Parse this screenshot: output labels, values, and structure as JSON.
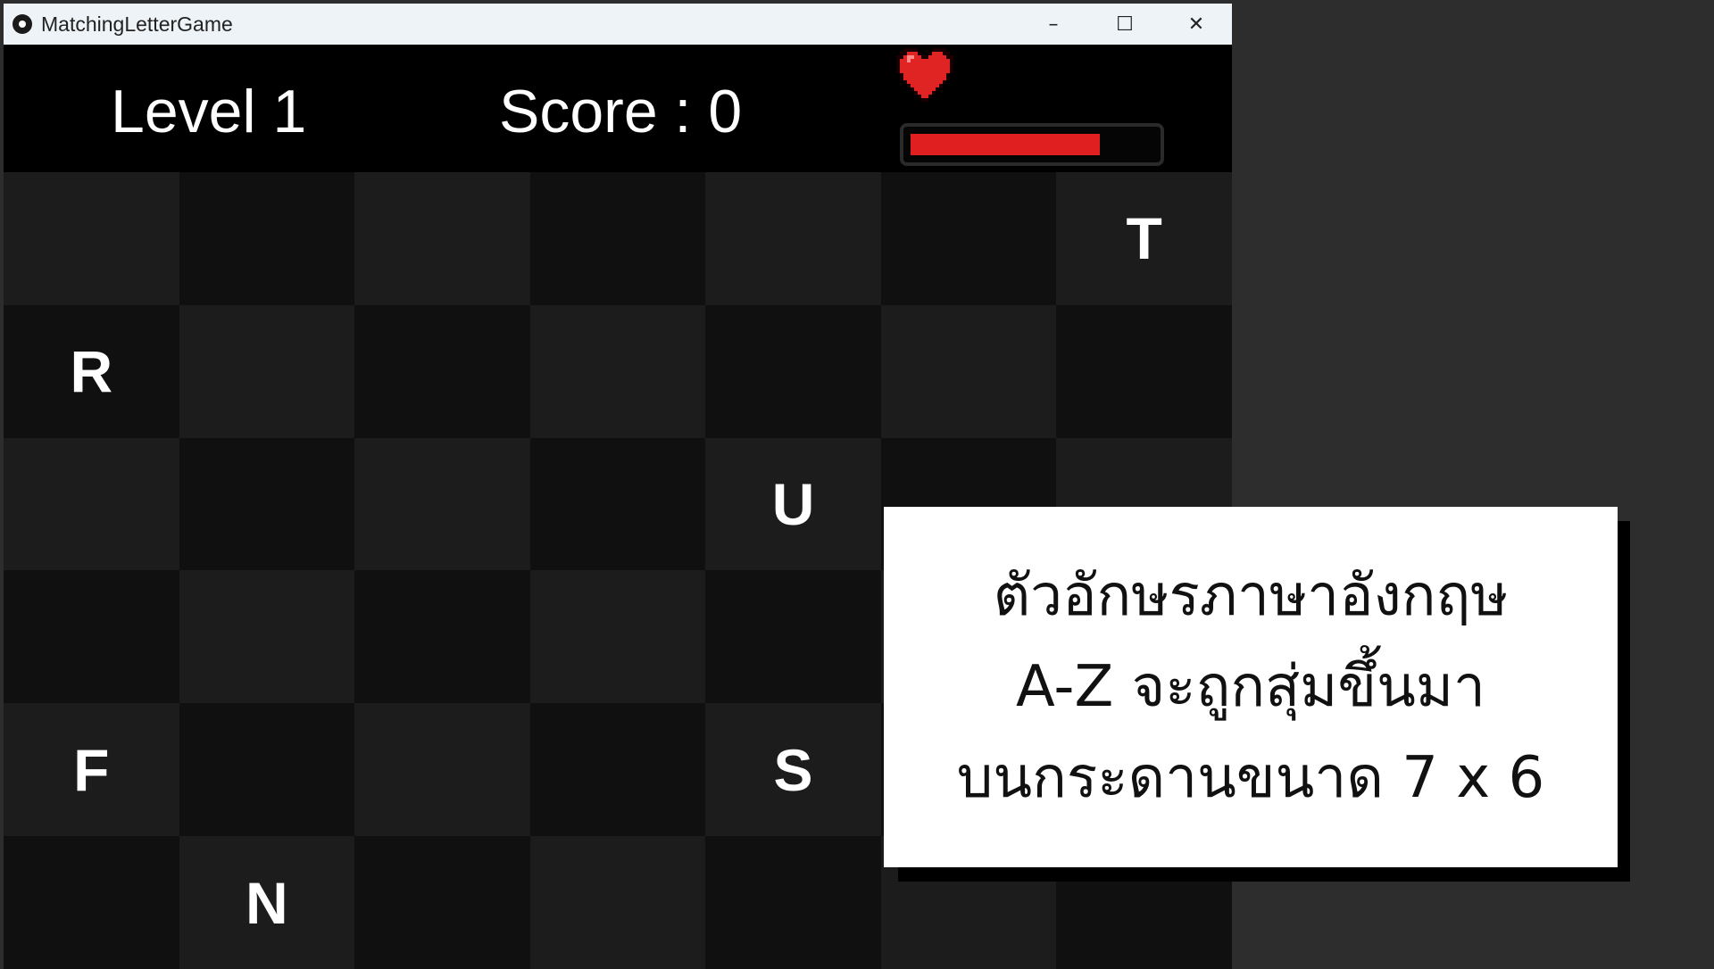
{
  "window": {
    "title": "MatchingLetterGame",
    "controls": [
      "–",
      "☐",
      "✕"
    ]
  },
  "hud": {
    "level_label": "Level 1",
    "score_label": "Score : 0",
    "health_fraction": 0.78,
    "health_color": "#e02020",
    "heart_icon": "heart-icon"
  },
  "board": {
    "cols": 7,
    "rows": 6,
    "cells": [
      [
        "",
        "",
        "",
        "",
        "",
        "",
        "T"
      ],
      [
        "R",
        "",
        "",
        "",
        "",
        "",
        ""
      ],
      [
        "",
        "",
        "",
        "",
        "U",
        "",
        ""
      ],
      [
        "",
        "",
        "",
        "",
        "",
        "",
        ""
      ],
      [
        "F",
        "",
        "",
        "",
        "S",
        "",
        ""
      ],
      [
        "",
        "N",
        "",
        "",
        "",
        "",
        ""
      ]
    ],
    "colors": {
      "light": "#1c1c1c",
      "dark": "#101010"
    }
  },
  "caption": {
    "lines": [
      "ตัวอักษรภาษาอังกฤษ",
      "A-Z จะถูกสุ่มขึ้นมา",
      "บนกระดานขนาด 7 x 6"
    ]
  }
}
